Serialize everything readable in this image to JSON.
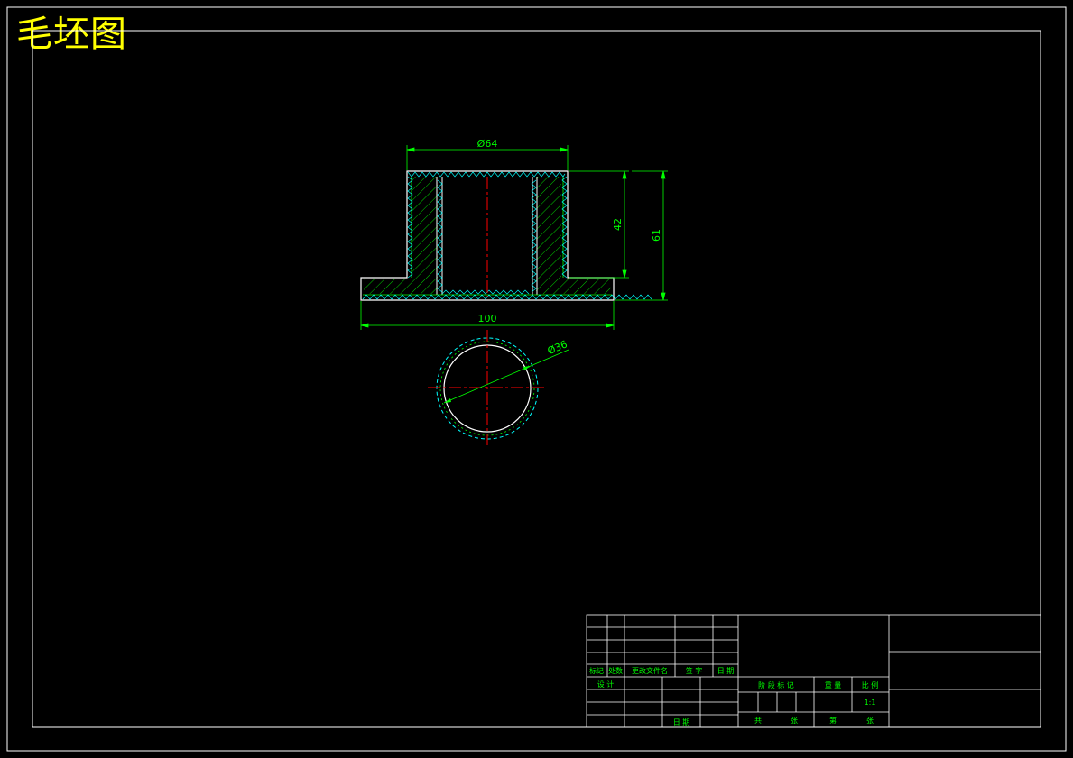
{
  "title": "毛坯图",
  "dimensions": {
    "top_diameter": "Ø64",
    "inner_height": "42",
    "total_height": "61",
    "base_width": "100",
    "bore_diameter": "Ø36"
  },
  "title_block": {
    "rev_headers": [
      "标记",
      "处数",
      "更改文件名",
      "签 字",
      "日 期"
    ],
    "design": "设 计",
    "date": "日 期",
    "stage_mark": "阶 段 标 记",
    "weight": "重 量",
    "scale_label": "比 例",
    "scale_value": "1:1",
    "total_sheets": "共",
    "sheet_unit": "张",
    "sheet_no": "第",
    "sheet_unit2": "张"
  },
  "colors": {
    "background": "#000000",
    "frame": "#ffffff",
    "geometry": "#00ff00",
    "hatch": "#00ff00",
    "knurl": "#00ffff",
    "centerline": "#ff0000",
    "title": "#ffff00"
  }
}
